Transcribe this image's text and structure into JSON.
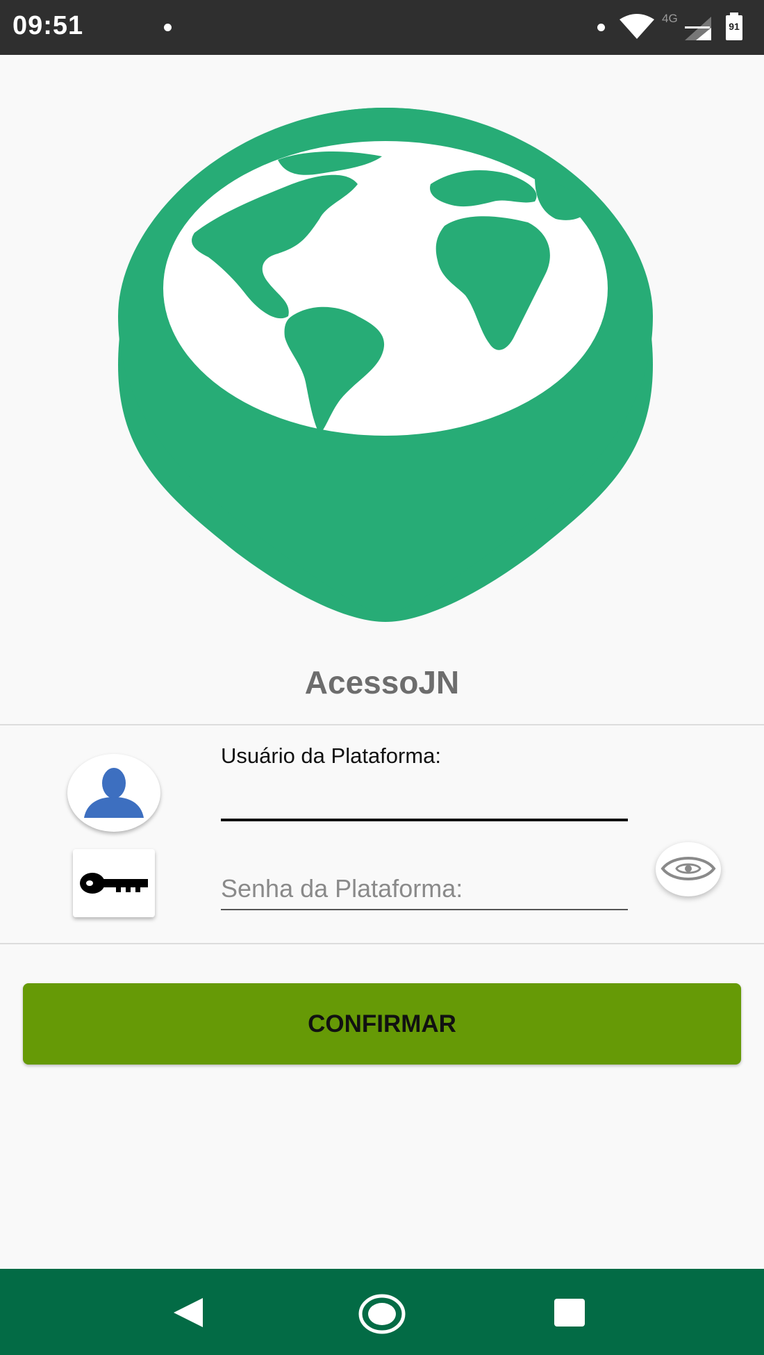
{
  "status_bar": {
    "time": "09:51",
    "network_label": "4G",
    "battery_level": "91",
    "icons": [
      "notification-dot-icon",
      "wifi-icon",
      "signal-icon",
      "battery-icon"
    ]
  },
  "logo": {
    "icon": "globe-map-pin-logo",
    "color": "#27ac76"
  },
  "app": {
    "title": "AcessoJN"
  },
  "form": {
    "user_label": "Usuário da Plataforma:",
    "user_value": "",
    "password_placeholder": "Senha da Plataforma:",
    "password_value": "",
    "user_icon": "user-avatar-icon",
    "password_icon": "key-icon",
    "show_password_icon": "eye-icon"
  },
  "actions": {
    "confirm_label": "CONFIRMAR",
    "confirm_color": "#669a06"
  },
  "nav_bar": {
    "color": "#036b45",
    "items": [
      "back-icon",
      "home-icon",
      "recents-icon"
    ]
  }
}
